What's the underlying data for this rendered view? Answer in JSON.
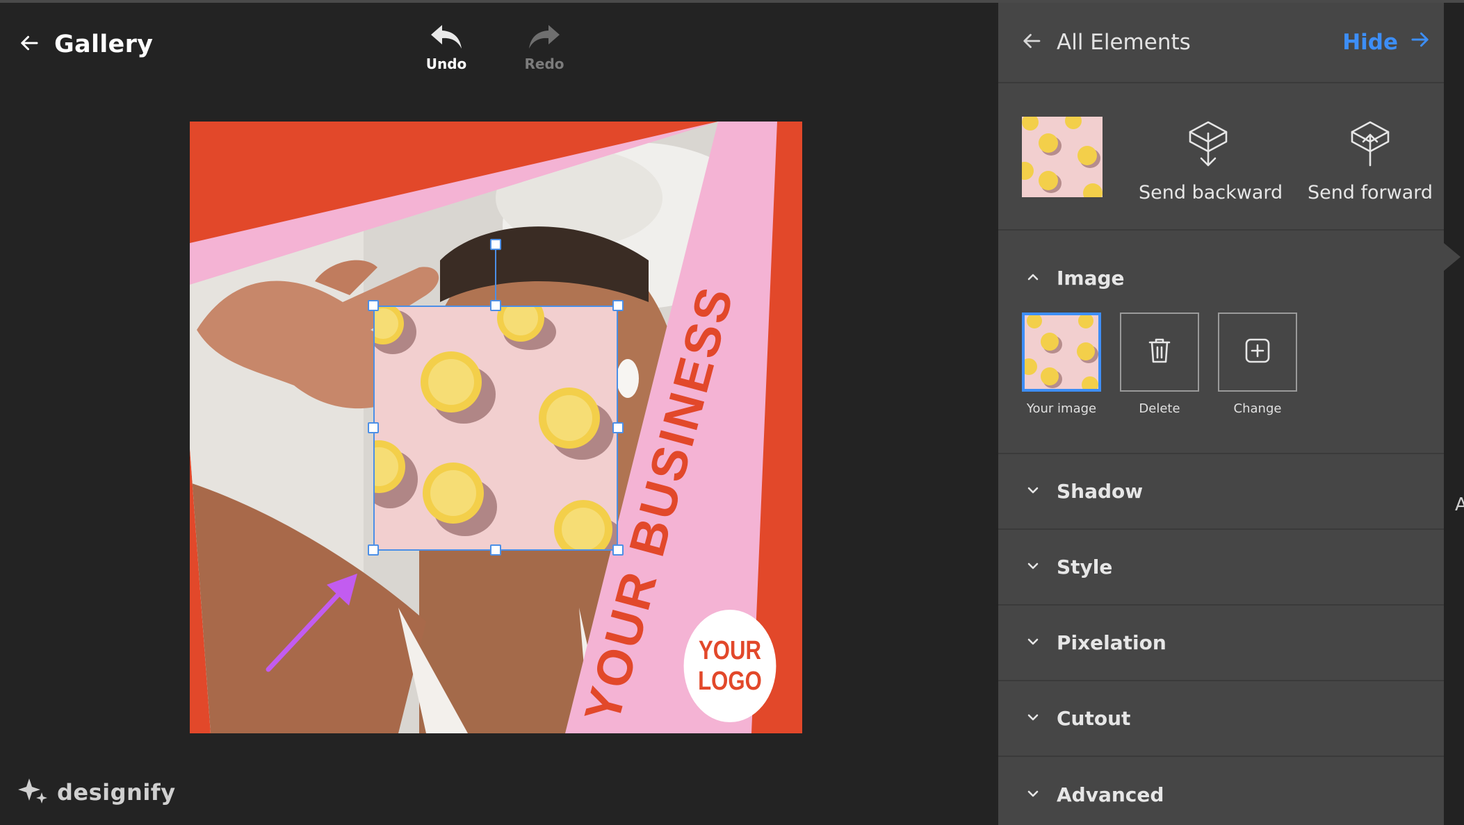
{
  "topbar": {
    "back_label": "Gallery",
    "undo_label": "Undo",
    "redo_label": "Redo"
  },
  "canvas": {
    "headline_text": "YOUR BUSINESS",
    "logo_line1": "YOUR",
    "logo_line2": "LOGO",
    "colors": {
      "background": "#e2482a",
      "pink": "#f4b3d4",
      "selection": "#4c8fe6",
      "annotation_arrow": "#c25cf0"
    }
  },
  "brand": {
    "name": "designify",
    "icon": "sparkle-icon"
  },
  "panel": {
    "back_label": "All Elements",
    "hide_label": "Hide",
    "send_backward_label": "Send backward",
    "send_forward_label": "Send forward",
    "image_section": {
      "title": "Image",
      "options": [
        {
          "label": "Your image",
          "icon": "image-thumbnail"
        },
        {
          "label": "Delete",
          "icon": "trash-icon"
        },
        {
          "label": "Change",
          "icon": "plus-square-icon"
        }
      ]
    },
    "sections": [
      {
        "title": "Shadow"
      },
      {
        "title": "Style"
      },
      {
        "title": "Pixelation"
      },
      {
        "title": "Cutout"
      },
      {
        "title": "Advanced"
      }
    ],
    "accent_color": "#3d8ef7"
  },
  "edge_glyph": "A"
}
